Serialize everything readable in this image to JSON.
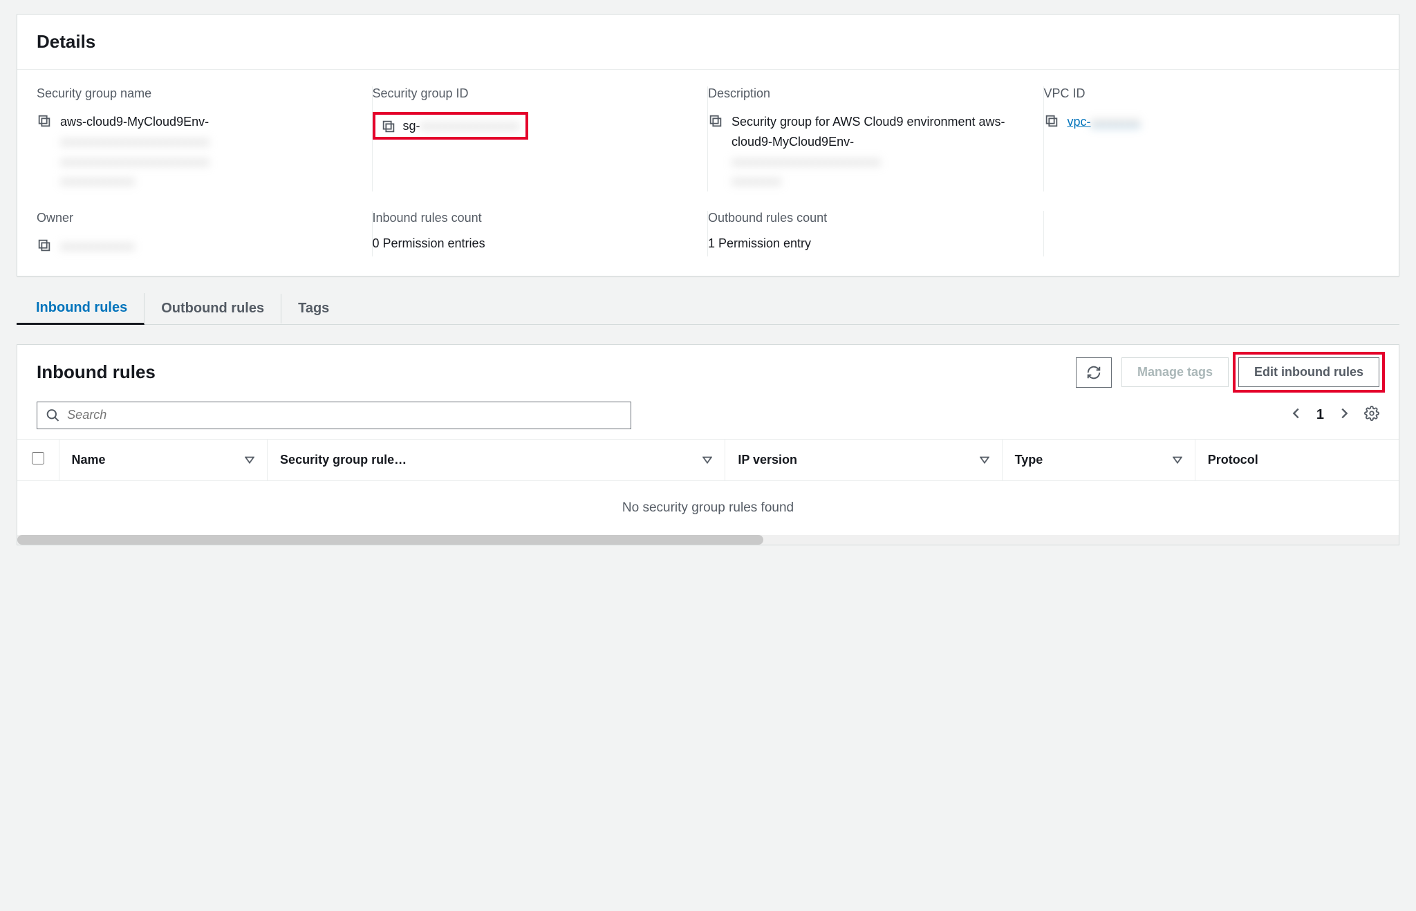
{
  "details": {
    "title": "Details",
    "fields": {
      "sg_name": {
        "label": "Security group name",
        "value": "aws-cloud9-MyCloud9Env-"
      },
      "sg_id": {
        "label": "Security group ID",
        "value": "sg-"
      },
      "desc": {
        "label": "Description",
        "value": "Security group for AWS Cloud9 environment aws-cloud9-MyCloud9Env-"
      },
      "vpc_id": {
        "label": "VPC ID",
        "value": "vpc-"
      },
      "owner": {
        "label": "Owner",
        "value": ""
      },
      "inbound": {
        "label": "Inbound rules count",
        "value": "0 Permission entries"
      },
      "outbound": {
        "label": "Outbound rules count",
        "value": "1 Permission entry"
      }
    }
  },
  "tabs": [
    {
      "id": "inbound",
      "label": "Inbound rules",
      "active": true
    },
    {
      "id": "outbound",
      "label": "Outbound rules",
      "active": false
    },
    {
      "id": "tags",
      "label": "Tags",
      "active": false
    }
  ],
  "rules": {
    "title": "Inbound rules",
    "buttons": {
      "refresh_tooltip": "Refresh",
      "manage_tags": "Manage tags",
      "edit_inbound": "Edit inbound rules"
    },
    "search_placeholder": "Search",
    "pagination": {
      "current_page": "1"
    },
    "columns": [
      "Name",
      "Security group rule…",
      "IP version",
      "Type",
      "Protocol"
    ],
    "empty_text": "No security group rules found"
  }
}
